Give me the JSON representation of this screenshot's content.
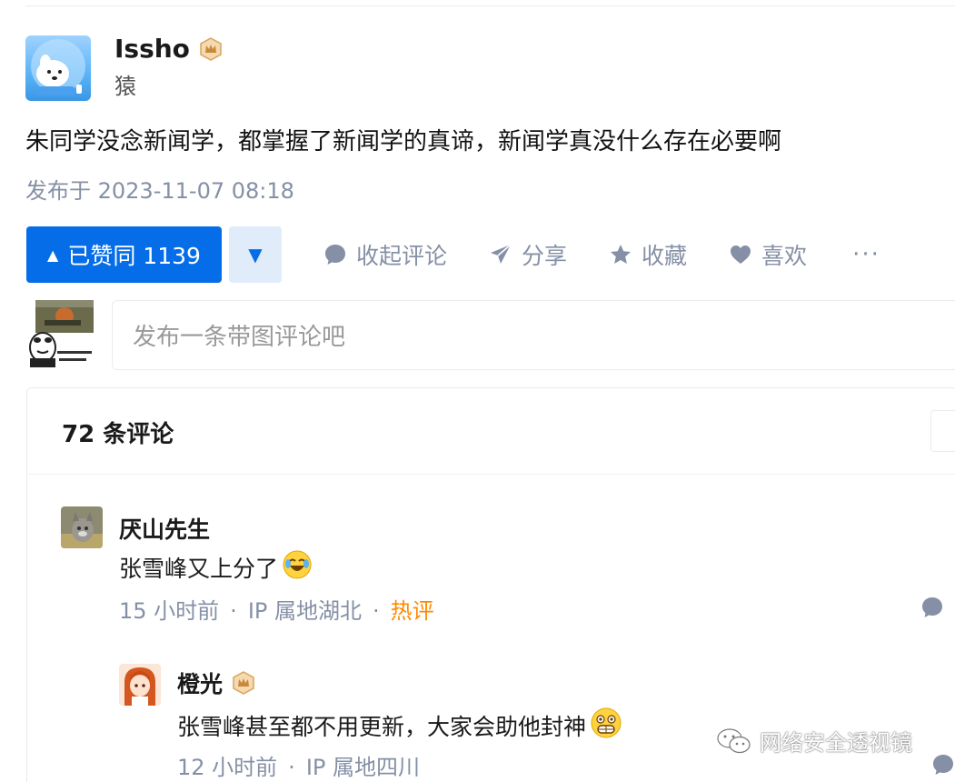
{
  "post": {
    "author_name": "Issho",
    "author_subtitle": "猿",
    "content": "朱同学没念新闻学，都掌握了新闻学的真谛，新闻学真没什么存在必要啊",
    "published": "发布于 2023-11-07 08:18"
  },
  "actions": {
    "upvote_label": "已赞同 1139",
    "upvote_icon": "▲",
    "downvote_icon": "▼",
    "collapse_comments": "收起评论",
    "share": "分享",
    "collect": "收藏",
    "like": "喜欢",
    "more": "···"
  },
  "comment_input": {
    "placeholder": "发布一条带图评论吧"
  },
  "comments": {
    "count_label": "72 条评论",
    "items": [
      {
        "author": "厌山先生",
        "text": "张雪峰又上分了",
        "time": "15 小时前",
        "ip": "IP 属地湖北",
        "badge": "热评"
      },
      {
        "author": "橙光",
        "text": "张雪峰甚至都不用更新，大家会助他封神",
        "time": "12 小时前",
        "ip": "IP 属地四川"
      }
    ]
  },
  "watermark": "网络安全透视镜",
  "colors": {
    "primary": "#056de8",
    "primary_light": "#e1ecfb",
    "meta_gray": "#8590a6",
    "hot_orange": "#ff8a00"
  }
}
